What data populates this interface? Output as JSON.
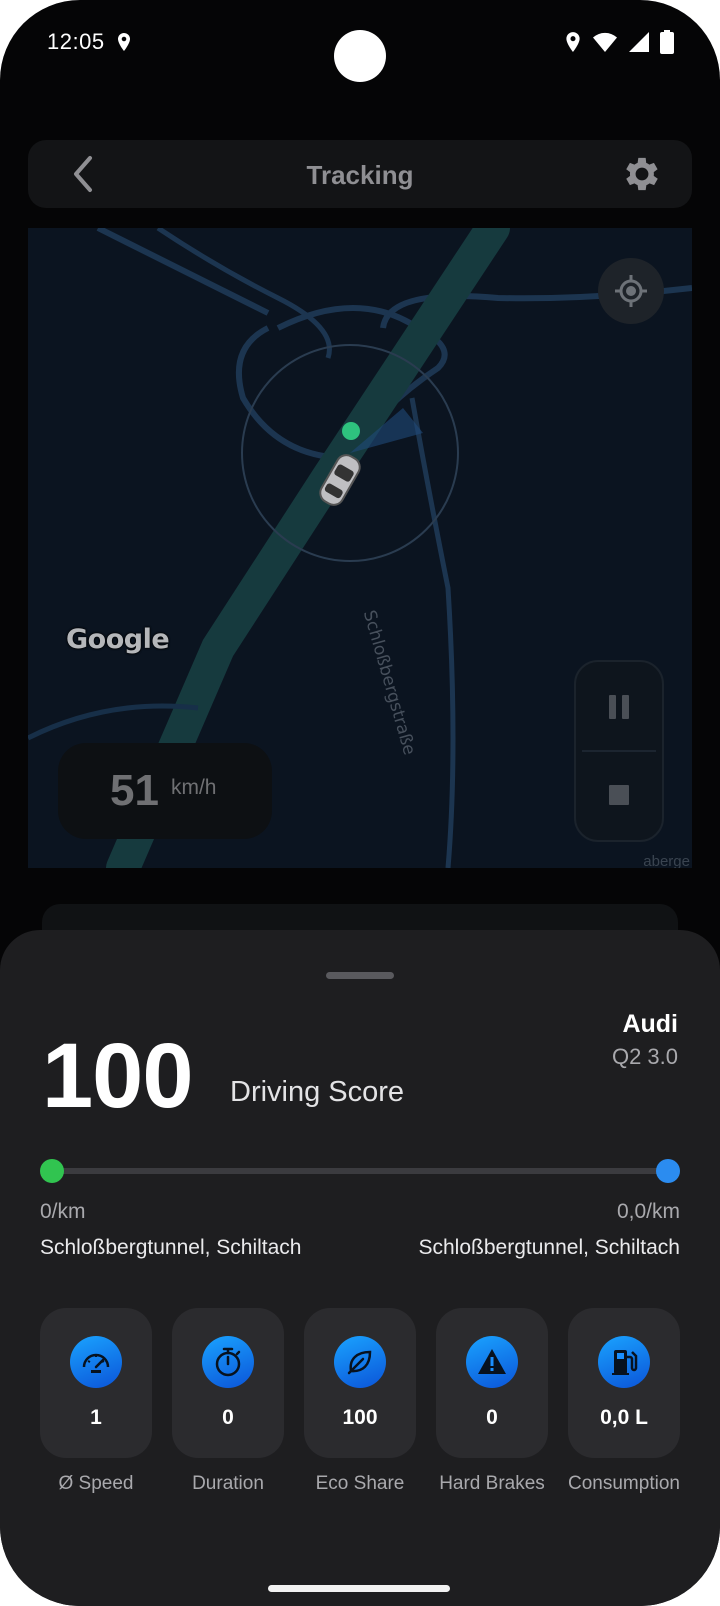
{
  "status_bar": {
    "time": "12:05"
  },
  "header": {
    "title": "Tracking"
  },
  "map": {
    "attribution": "Google",
    "street_name": "Schloßbergstraße",
    "corner_text": "aberge",
    "speed_value": "51",
    "speed_unit": "km/h"
  },
  "score": {
    "value": "100",
    "label": "Driving Score",
    "car_brand": "Audi",
    "car_model": "Q2 3.0"
  },
  "route": {
    "start_distance": "0/km",
    "end_distance": "0,0/km",
    "start_place": "Schloßbergtunnel, Schiltach",
    "end_place": "Schloßbergtunnel, Schiltach"
  },
  "stats": [
    {
      "icon": "speedometer-icon",
      "value": "1",
      "label": "Ø Speed"
    },
    {
      "icon": "stopwatch-icon",
      "value": "0",
      "label": "Duration"
    },
    {
      "icon": "leaf-icon",
      "value": "100",
      "label": "Eco Share"
    },
    {
      "icon": "warning-icon",
      "value": "0",
      "label": "Hard Brakes"
    },
    {
      "icon": "fuel-pump-icon",
      "value": "0,0 L",
      "label": "Consumption"
    }
  ],
  "colors": {
    "accent_blue": "#2b8cf0",
    "start_green": "#31c450",
    "sheet_bg": "#1e1e20",
    "card_bg": "#2b2b2e"
  }
}
